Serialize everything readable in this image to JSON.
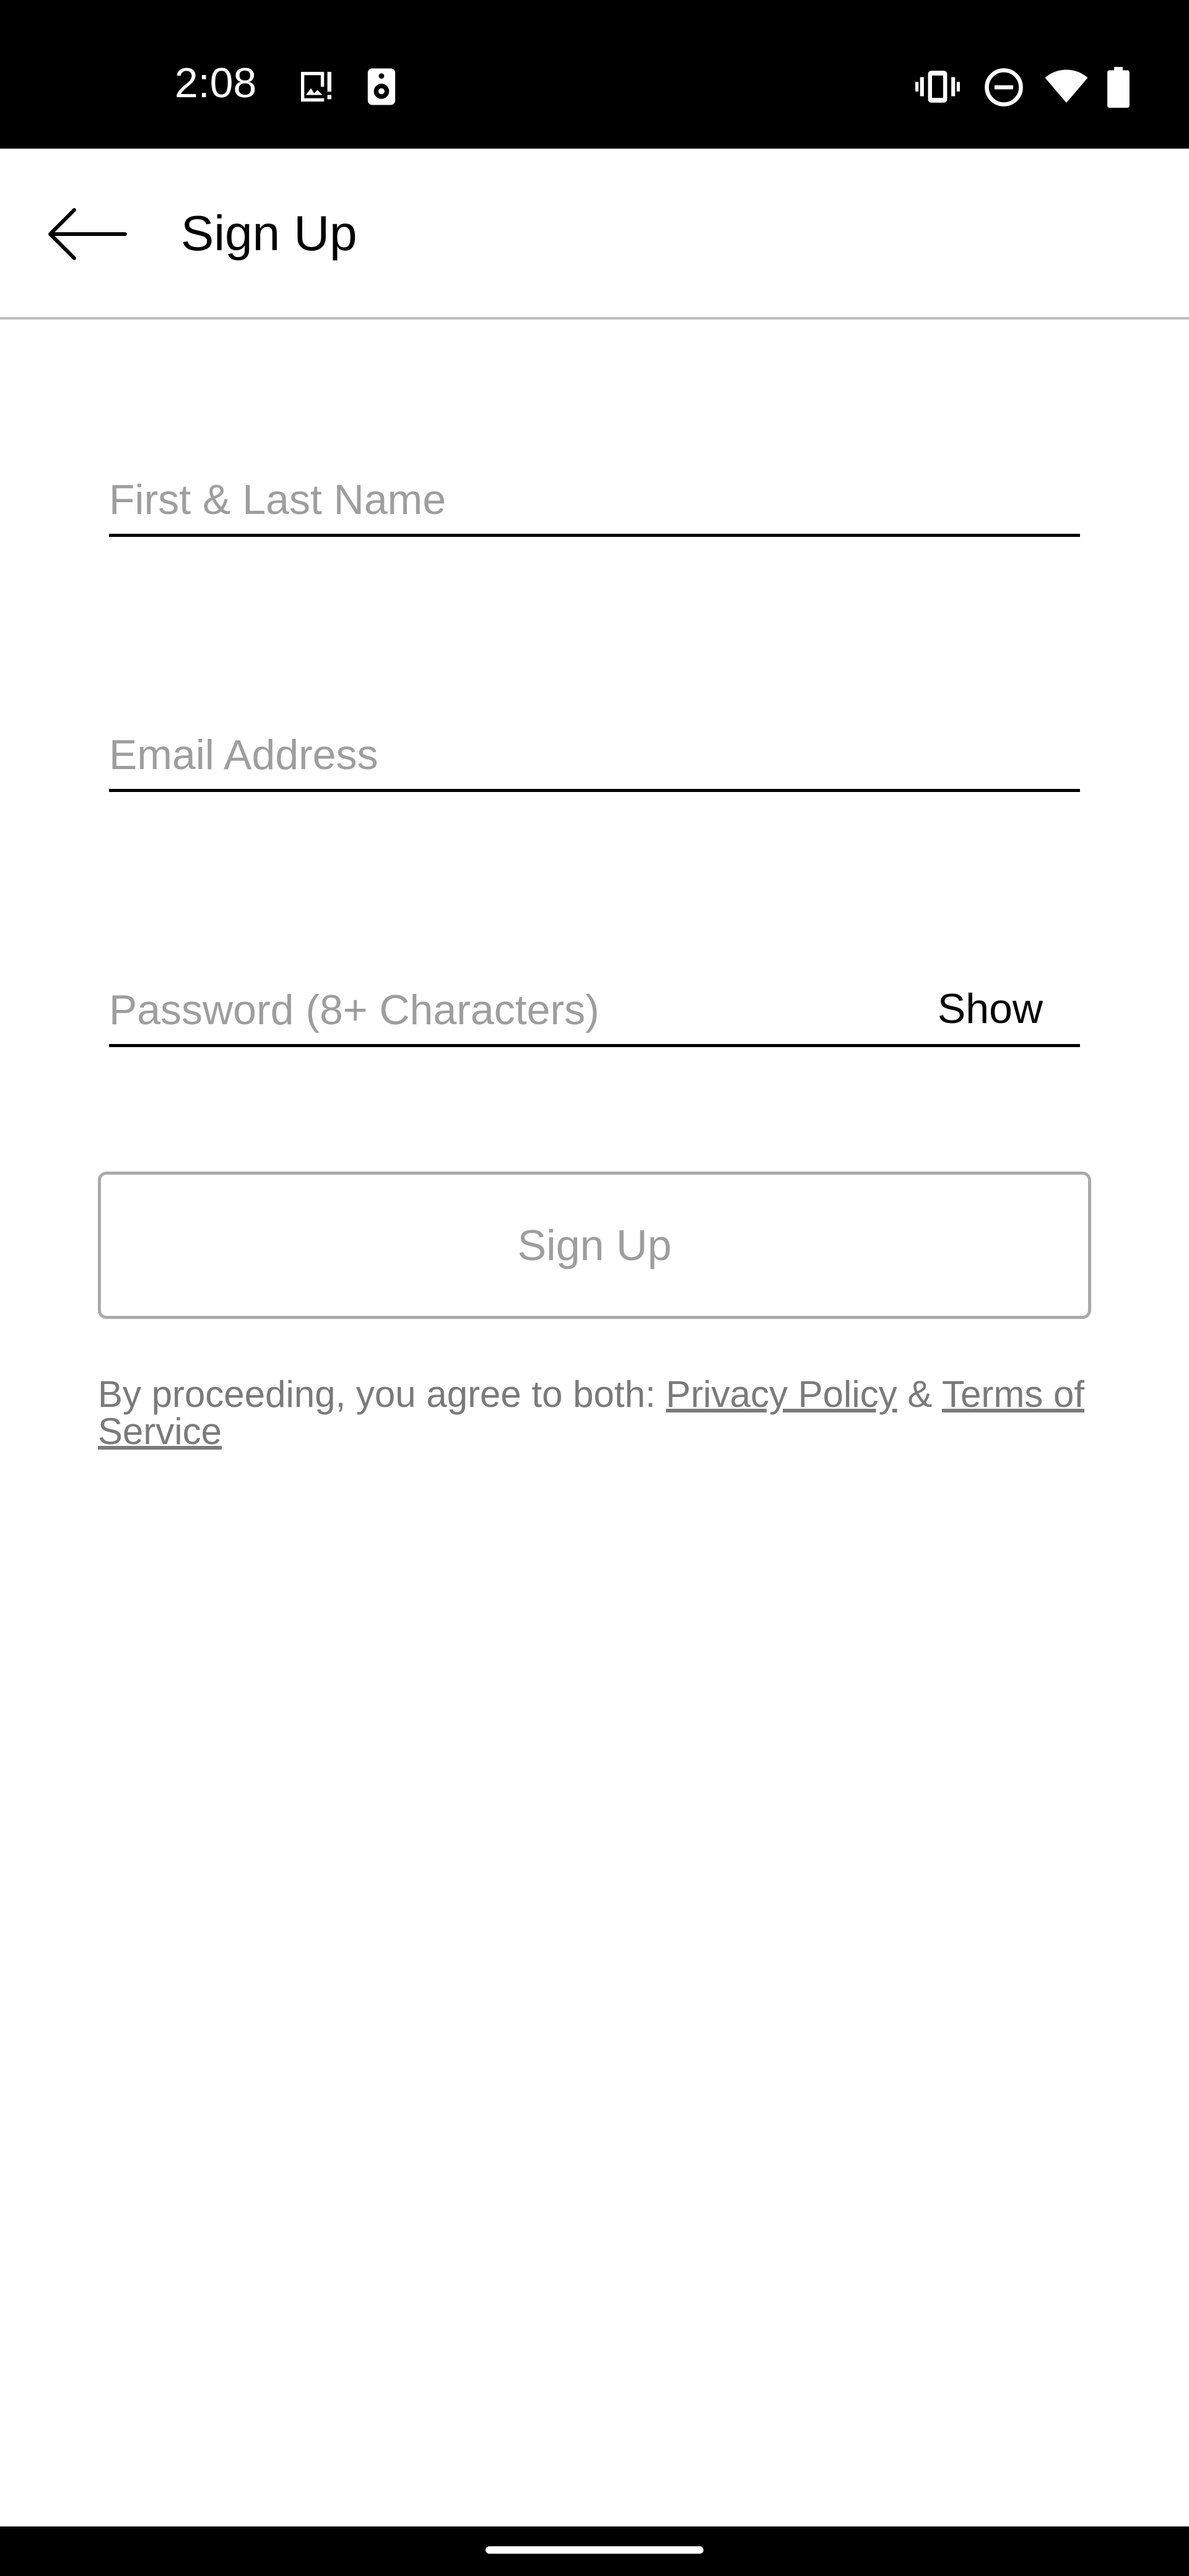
{
  "status_bar": {
    "time": "2:08",
    "icons_left": [
      "image-alert-icon",
      "speaker-icon"
    ],
    "icons_right": [
      "vibrate-icon",
      "do-not-disturb-icon",
      "wifi-icon",
      "battery-icon"
    ]
  },
  "header": {
    "back_icon": "arrow-left-icon",
    "title": "Sign Up"
  },
  "form": {
    "name_placeholder": "First & Last Name",
    "email_placeholder": "Email Address",
    "password_placeholder": "Password (8+ Characters)",
    "show_label": "Show",
    "submit_label": "Sign Up"
  },
  "legal": {
    "prefix": "By proceeding, you agree to both: ",
    "privacy_link": "Privacy Policy",
    "joiner": " & ",
    "terms_link": "Terms of Service"
  },
  "colors": {
    "status_bar_bg": "#000000",
    "placeholder": "#9e9e9e",
    "button_border": "#aaaaaa",
    "legal_text": "#7a7a7a"
  }
}
